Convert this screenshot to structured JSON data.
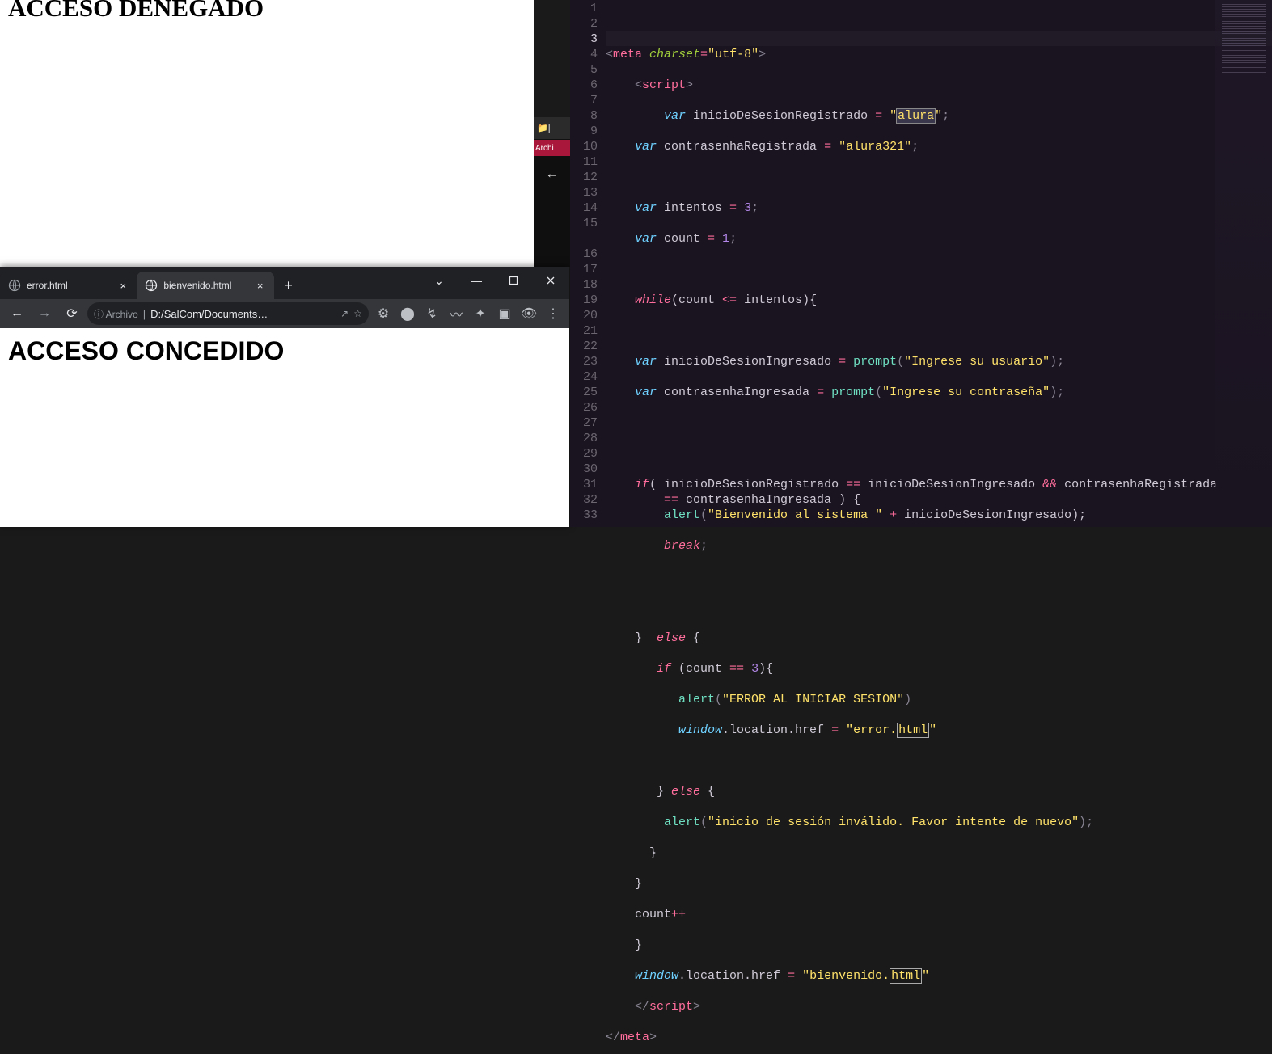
{
  "page_top": {
    "heading": "ACCESO DENEGADO"
  },
  "peek": {
    "folder_label": "|",
    "menu_label": "Archi",
    "back_glyph": "←"
  },
  "chrome": {
    "tabs": [
      {
        "title": "error.html",
        "active": false
      },
      {
        "title": "bienvenido.html",
        "active": true
      }
    ],
    "newtab_glyph": "+",
    "win": {
      "expand_glyph": "⌄",
      "min_glyph": "—"
    },
    "nav": {
      "back": "←",
      "fwd": "→",
      "reload": "⟳"
    },
    "omnibox": {
      "secure_label": "ⓘ Archivo",
      "url_prefix": "| ",
      "url": "D:/SalCom/Documents…",
      "share_glyph": "↗",
      "star_glyph": "☆"
    },
    "ext_icons": [
      "⚙",
      "⬤",
      "↯",
      "〰",
      "✦",
      "▣",
      "👁"
    ],
    "menu_glyph": "⋮",
    "content_heading": "ACCESO CONCEDIDO"
  },
  "editor": {
    "active_line": 3,
    "line_numbers": [
      1,
      2,
      3,
      4,
      5,
      6,
      7,
      8,
      9,
      10,
      11,
      12,
      13,
      14,
      15,
      16,
      17,
      18,
      19,
      20,
      21,
      22,
      23,
      24,
      25,
      26,
      27,
      28,
      29,
      30,
      31,
      32,
      33
    ],
    "code": {
      "l1": {
        "a": "<",
        "b": "meta",
        "c": " charset",
        "d": "=",
        "e": "\"utf-8\"",
        "f": ">"
      },
      "l2": {
        "a": "<",
        "b": "script",
        "c": ">"
      },
      "l3": {
        "a": "var",
        "b": " inicioDeSesionRegistrado ",
        "c": "=",
        "d": " ",
        "e": "\"",
        "f": "alura",
        "g": "\"",
        "h": ";"
      },
      "l4": {
        "a": "var",
        "b": " contrasenhaRegistrada ",
        "c": "=",
        "d": " ",
        "e": "\"alura321\"",
        "f": ";"
      },
      "l6": {
        "a": "var",
        "b": " intentos ",
        "c": "=",
        "d": " ",
        "e": "3",
        "f": ";"
      },
      "l7": {
        "a": "var",
        "b": " count ",
        "c": "=",
        "d": " ",
        "e": "1",
        "f": ";"
      },
      "l9": {
        "a": "while",
        "b": "(count ",
        "c": "<=",
        "d": " intentos){"
      },
      "l11": {
        "a": "var",
        "b": " inicioDeSesionIngresado ",
        "c": "=",
        "d": " ",
        "e": "prompt",
        "f": "(",
        "g": "\"Ingrese su usuario\"",
        "h": ");"
      },
      "l12": {
        "a": "var",
        "b": " contrasenhaIngresada ",
        "c": "=",
        "d": " ",
        "e": "prompt",
        "f": "(",
        "g": "\"Ingrese su contraseña\"",
        "h": ");"
      },
      "l15": {
        "a": "if",
        "b": "( inicioDeSesionRegistrado ",
        "c": "==",
        "d": " inicioDeSesionIngresado ",
        "e": "&&",
        "f": " contrasenhaRegistrada ",
        "g": "==",
        "h": " contrasenhaIngresada ) {"
      },
      "l16": {
        "a": "alert",
        "b": "(",
        "c": "\"Bienvenido al sistema \"",
        "d": " ",
        "e": "+",
        "f": " inicioDeSesionIngresado);"
      },
      "l17": {
        "a": "break",
        "b": ";"
      },
      "l20": {
        "a": "}  ",
        "b": "else",
        "c": " {"
      },
      "l21": {
        "a": "if",
        "b": " (count ",
        "c": "==",
        "d": " ",
        "e": "3",
        "f": "){"
      },
      "l22": {
        "a": "alert",
        "b": "(",
        "c": "\"ERROR AL INICIAR SESION\"",
        "d": ")"
      },
      "l23": {
        "a": "window",
        "b": ".location.href ",
        "c": "=",
        "d": " ",
        "e": "\"error.",
        "f": "html",
        "g": "\""
      },
      "l25": {
        "a": "} ",
        "b": "else",
        "c": " {"
      },
      "l26": {
        "a": "alert",
        "b": "(",
        "c": "\"inicio de sesión inválido. Favor intente de nuevo\"",
        "d": ");"
      },
      "l27": {
        "a": "}"
      },
      "l28": {
        "a": "}"
      },
      "l29": {
        "a": "count",
        "b": "++"
      },
      "l30": {
        "a": "}"
      },
      "l31": {
        "a": "window",
        "b": ".location.href ",
        "c": "=",
        "d": " ",
        "e": "\"bienvenido.",
        "f": "html",
        "g": "\""
      },
      "l32": {
        "a": "</",
        "b": "script",
        "c": ">"
      },
      "l33": {
        "a": "</",
        "b": "meta",
        "c": ">"
      }
    }
  }
}
